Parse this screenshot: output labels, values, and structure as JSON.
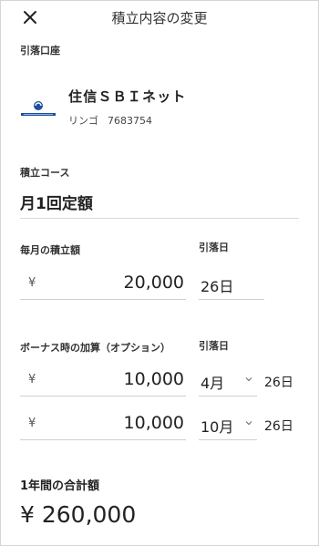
{
  "header": {
    "title": "積立内容の変更"
  },
  "account": {
    "section_label": "引落口座",
    "bank_name": "住信ＳＢＩネット",
    "holder_name": "リンゴ",
    "account_number": "7683754"
  },
  "course": {
    "label": "積立コース",
    "value": "月1回定額"
  },
  "monthly": {
    "label": "毎月の積立額",
    "currency": "¥",
    "amount": "20,000",
    "debit_label": "引落日",
    "debit_day": "26日"
  },
  "bonus": {
    "label": "ボーナス時の加算（オプション）",
    "debit_label": "引落日",
    "rows": [
      {
        "currency": "¥",
        "amount": "10,000",
        "month": "4月",
        "day": "26日"
      },
      {
        "currency": "¥",
        "amount": "10,000",
        "month": "10月",
        "day": "26日"
      }
    ]
  },
  "total": {
    "label": "1年間の合計額",
    "value": "¥ 260,000"
  },
  "colors": {
    "logo_blue": "#1d4f9c",
    "logo_bg": "#1d4f9c"
  },
  "icons": {
    "close": "close-icon",
    "chevron": "chevron-down-icon",
    "bank": "bank-logo-icon"
  }
}
